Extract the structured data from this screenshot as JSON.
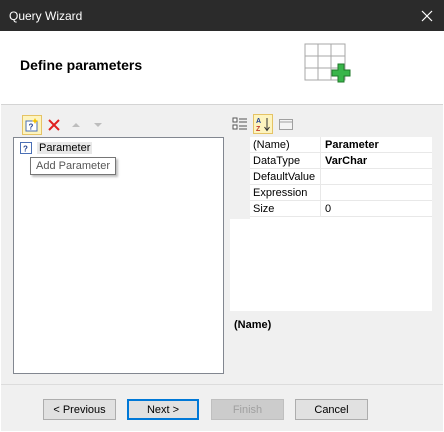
{
  "window": {
    "title": "Query Wizard"
  },
  "header": {
    "heading": "Define parameters"
  },
  "left_toolbar": {
    "add_tooltip": "Add Parameter"
  },
  "tree": {
    "items": [
      {
        "label": "Parameter"
      }
    ]
  },
  "property_grid": {
    "rows": [
      {
        "name": "(Name)",
        "value": "Parameter",
        "bold": true
      },
      {
        "name": "DataType",
        "value": "VarChar",
        "bold": true
      },
      {
        "name": "DefaultValue",
        "value": ""
      },
      {
        "name": "Expression",
        "value": ""
      },
      {
        "name": "Size",
        "value": "0"
      }
    ],
    "description": "(Name)"
  },
  "footer": {
    "previous_label": "< Previous",
    "next_label": "Next >",
    "finish_label": "Finish",
    "cancel_label": "Cancel"
  },
  "colors": {
    "titlebar": "#2b2b2b",
    "accent_green": "#39b54a",
    "delete_red": "#e02020",
    "default_button_border": "#0078d7"
  }
}
